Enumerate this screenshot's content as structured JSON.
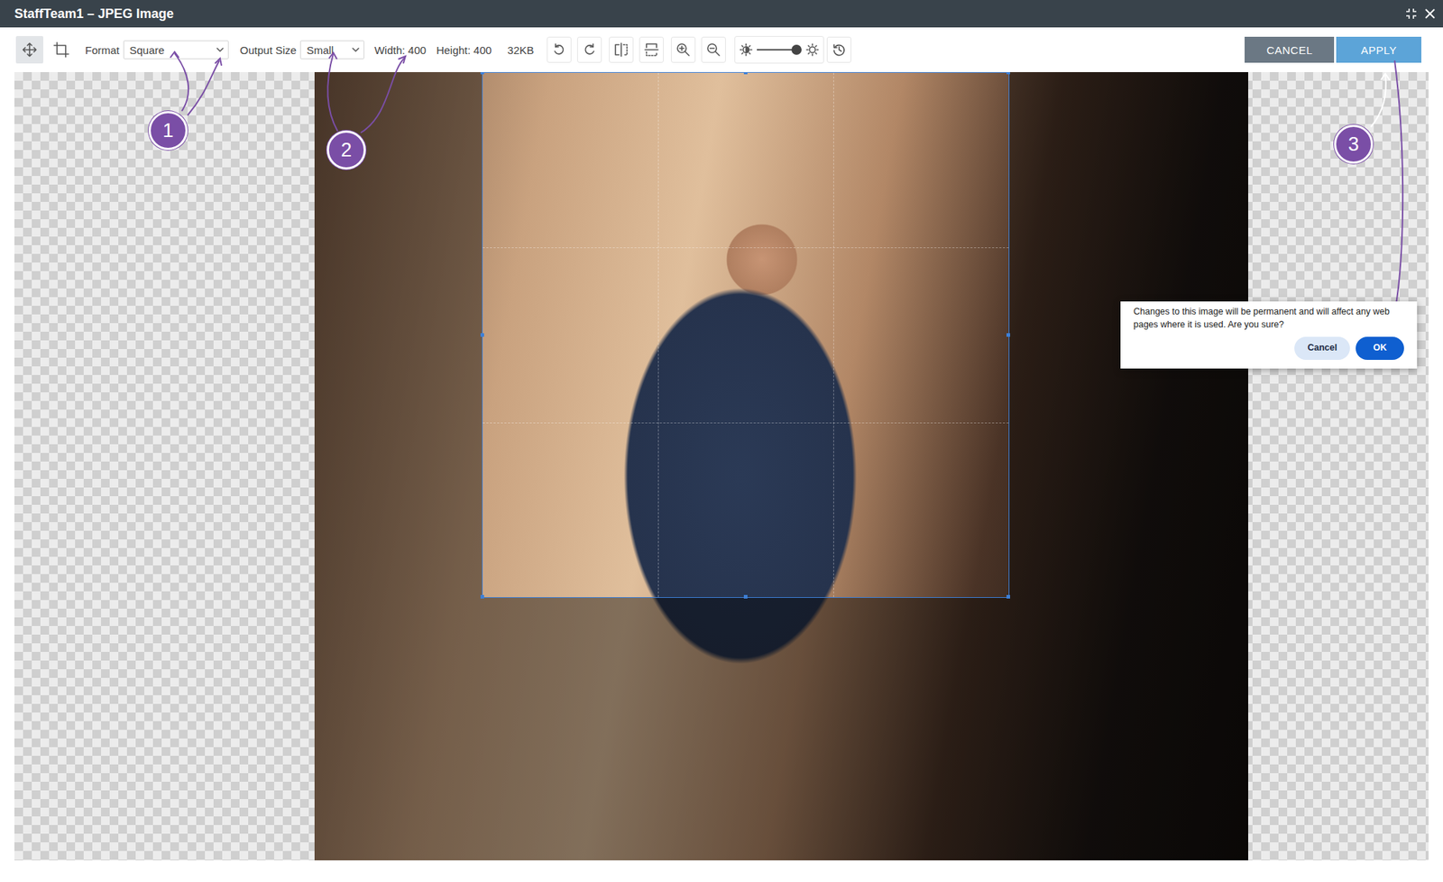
{
  "window": {
    "title": "StaffTeam1 – JPEG Image"
  },
  "toolbar": {
    "move_tool": {
      "selected": true
    },
    "crop_tool": {
      "selected": false
    },
    "format": {
      "label": "Format",
      "value": "Square"
    },
    "output_size": {
      "label": "Output Size",
      "value": "Small"
    },
    "width": "Width: 400",
    "height": "Height: 400",
    "file_size": "32KB",
    "brightness": {
      "level": 0.88
    }
  },
  "buttons": [
    {
      "label": "CANCEL",
      "kind": "secondary"
    },
    {
      "label": "APPLY",
      "kind": "primary"
    }
  ],
  "annotations": [
    {
      "label": "1"
    },
    {
      "label": "2"
    },
    {
      "label": "3"
    }
  ],
  "dialog": {
    "message": "Changes to this image will be permanent and will affect any web pages where it is used. Are you sure?",
    "buttons": [
      {
        "label": "Cancel",
        "kind": "secondary"
      },
      {
        "label": "OK",
        "kind": "primary"
      }
    ]
  }
}
